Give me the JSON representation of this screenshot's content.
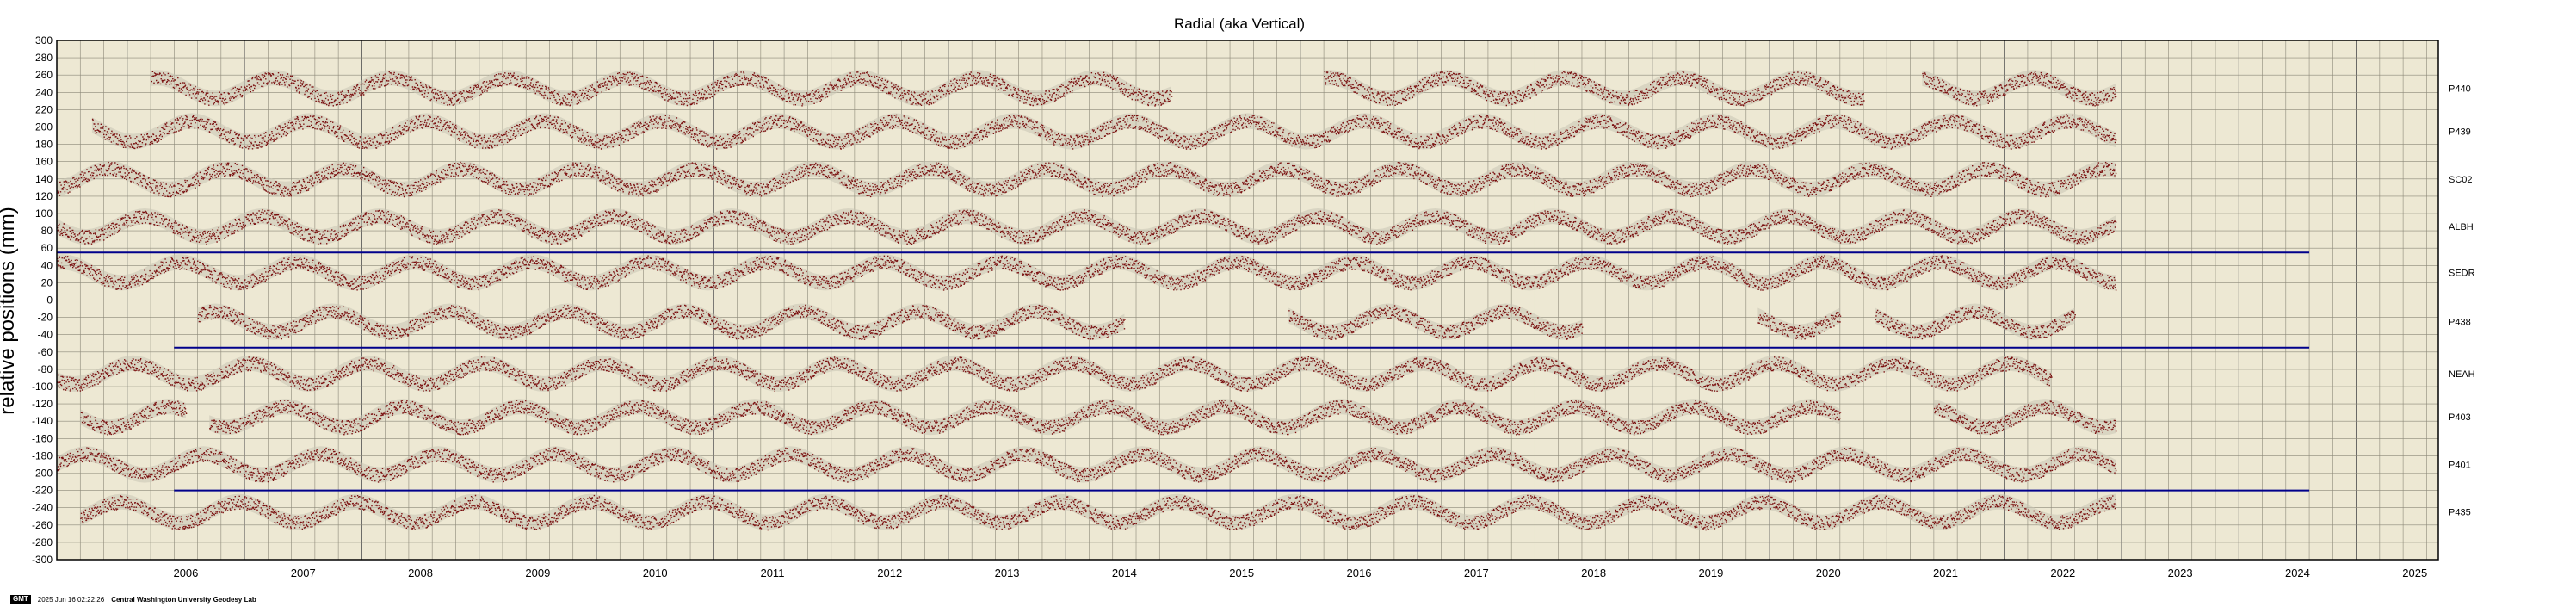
{
  "chart_data": {
    "type": "scatter",
    "title": "Radial (aka Vertical)",
    "ylabel": "relative positions (mm)",
    "xlabel": "",
    "xlim": [
      2005.4,
      2025.7
    ],
    "ylim": [
      -300,
      300
    ],
    "yticks": [
      300,
      280,
      260,
      240,
      220,
      200,
      180,
      160,
      140,
      120,
      100,
      80,
      60,
      40,
      20,
      0,
      -20,
      -40,
      -60,
      -80,
      -100,
      -120,
      -140,
      -160,
      -180,
      -200,
      -220,
      -240,
      -260,
      -280,
      -300
    ],
    "xtick_labels": [
      "2006",
      "2007",
      "2008",
      "2009",
      "2010",
      "2011",
      "2012",
      "2013",
      "2014",
      "2015",
      "2016",
      "2017",
      "2018",
      "2019",
      "2020",
      "2021",
      "2022",
      "2023",
      "2024",
      "2025"
    ],
    "grid": true,
    "background": "#ede8d3",
    "point_color": "#7a0f0f",
    "band_color": "#c9c4b4",
    "series": [
      {
        "name": "P440",
        "offset": 245,
        "segments": [
          [
            2006.2,
            2014.9
          ],
          [
            2016.2,
            2020.8
          ],
          [
            2021.3,
            2022.95
          ]
        ]
      },
      {
        "name": "P439",
        "offset": 195,
        "segments": [
          [
            2005.7,
            2022.95
          ]
        ]
      },
      {
        "name": "SC02",
        "offset": 140,
        "segments": [
          [
            2005.4,
            2022.95
          ]
        ]
      },
      {
        "name": "ALBH",
        "offset": 85,
        "segments": [
          [
            2005.4,
            2022.95
          ]
        ]
      },
      {
        "name": "SEDR",
        "offset": 32,
        "segments": [
          [
            2005.4,
            2022.95
          ]
        ]
      },
      {
        "name": "P438",
        "offset": -25,
        "segments": [
          [
            2006.6,
            2014.5
          ],
          [
            2015.9,
            2018.4
          ],
          [
            2019.9,
            2020.6
          ],
          [
            2020.9,
            2022.6
          ]
        ]
      },
      {
        "name": "NEAH",
        "offset": -85,
        "segments": [
          [
            2005.4,
            2022.4
          ]
        ]
      },
      {
        "name": "P403",
        "offset": -135,
        "segments": [
          [
            2005.6,
            2006.5
          ],
          [
            2006.7,
            2020.6
          ],
          [
            2021.4,
            2022.95
          ]
        ]
      },
      {
        "name": "P401",
        "offset": -190,
        "segments": [
          [
            2005.4,
            2022.95
          ]
        ]
      },
      {
        "name": "P435",
        "offset": -245,
        "segments": [
          [
            2005.6,
            2022.95
          ]
        ]
      }
    ],
    "reference_lines": [
      {
        "y": 55,
        "x": [
          2005.4,
          2024.6
        ],
        "color": "#00008b"
      },
      {
        "y": -55,
        "x": [
          2006.4,
          2024.6
        ],
        "color": "#00008b"
      },
      {
        "y": -220,
        "x": [
          2006.4,
          2024.6
        ],
        "color": "#00008b"
      }
    ]
  },
  "footer": {
    "badge": "GMT",
    "timestamp": "2025 Jun 16 02:22:26",
    "org": "Central Washington University Geodesy Lab"
  }
}
